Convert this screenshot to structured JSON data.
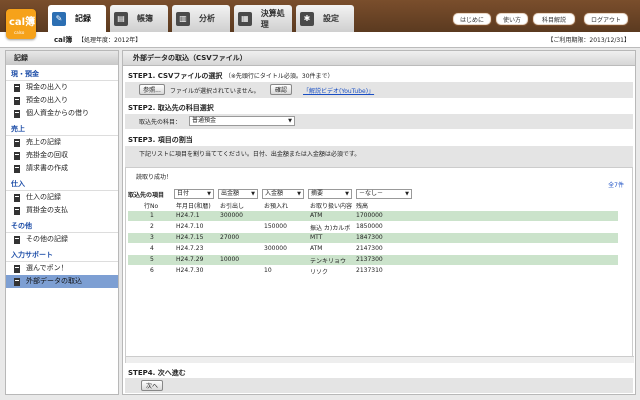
{
  "app": {
    "logo_title": "cal簿",
    "logo_sub": "calso",
    "name": "cal簿",
    "year": "【処理年度：2012年】",
    "due": "【ご利用期限：2013/12/31】"
  },
  "tabs": [
    {
      "label": "記録",
      "active": true,
      "icon": "pencil-icon"
    },
    {
      "label": "帳簿",
      "active": false,
      "icon": "book-icon"
    },
    {
      "label": "分析",
      "active": false,
      "icon": "chart-icon"
    },
    {
      "label": "決算処理",
      "active": false,
      "icon": "calculator-icon"
    },
    {
      "label": "設定",
      "active": false,
      "icon": "gear-icon"
    }
  ],
  "header_links": [
    "はじめに",
    "使い方",
    "科目解説",
    "ログアウト"
  ],
  "sidebar": {
    "title": "記録",
    "sections": [
      {
        "title": "現・預金",
        "items": [
          "現金の出入り",
          "預金の出入り",
          "個人資金からの借り"
        ]
      },
      {
        "title": "売上",
        "items": [
          "売上の記録",
          "売掛金の回収",
          "請求書の作成"
        ]
      },
      {
        "title": "仕入",
        "items": [
          "仕入の記録",
          "買掛金の支払"
        ]
      },
      {
        "title": "その他",
        "items": [
          "その他の記録"
        ]
      },
      {
        "title": "入力サポート",
        "items": [
          "選んでポン！",
          "外部データの取込"
        ]
      }
    ],
    "selected": "外部データの取込"
  },
  "main": {
    "title": "外部データの取込（CSVファイル）",
    "step1": {
      "title": "STEP1. CSVファイルの選択",
      "note": "（※先頭行にタイトル必須。30件まで）",
      "browse": "参照...",
      "status": "ファイルが選択されていません。",
      "confirm": "確認",
      "video_link": "「解説ビデオ(YouTube)」"
    },
    "step2": {
      "title": "STEP2. 取込先の科目選択",
      "label": "取込先の科目：",
      "account": "普通預金"
    },
    "step3": {
      "title": "STEP3. 項目の割当",
      "instruction": "下記リストに項目を割り当ててください。日付、出金額または入金額は必須です。"
    },
    "success": "読取り成功！",
    "count": "全7件",
    "map_label": "取込先の項目",
    "selects": [
      "日付",
      "出金額",
      "入金額",
      "摘要",
      "－なし－"
    ],
    "header_row": [
      "行No",
      "年月日(和暦)",
      "お引出し",
      "お預入れ",
      "お取り扱い内容",
      "残高"
    ],
    "rows": [
      [
        "1",
        "H24.7.1",
        "300000",
        "",
        "ATM",
        "1700000"
      ],
      [
        "2",
        "H24.7.10",
        "",
        "150000",
        "振込 カ)カルボ",
        "1850000"
      ],
      [
        "3",
        "H24.7.15",
        "27000",
        "",
        "MTT",
        "1847300"
      ],
      [
        "4",
        "H24.7.23",
        "",
        "300000",
        "ATM",
        "2147300"
      ],
      [
        "5",
        "H24.7.29",
        "10000",
        "",
        "テンキリョウ",
        "2137300"
      ],
      [
        "6",
        "H24.7.30",
        "",
        "10",
        "リソク",
        "2137310"
      ]
    ],
    "step4": {
      "title": "STEP4. 次へ進む",
      "next": "次へ"
    }
  }
}
